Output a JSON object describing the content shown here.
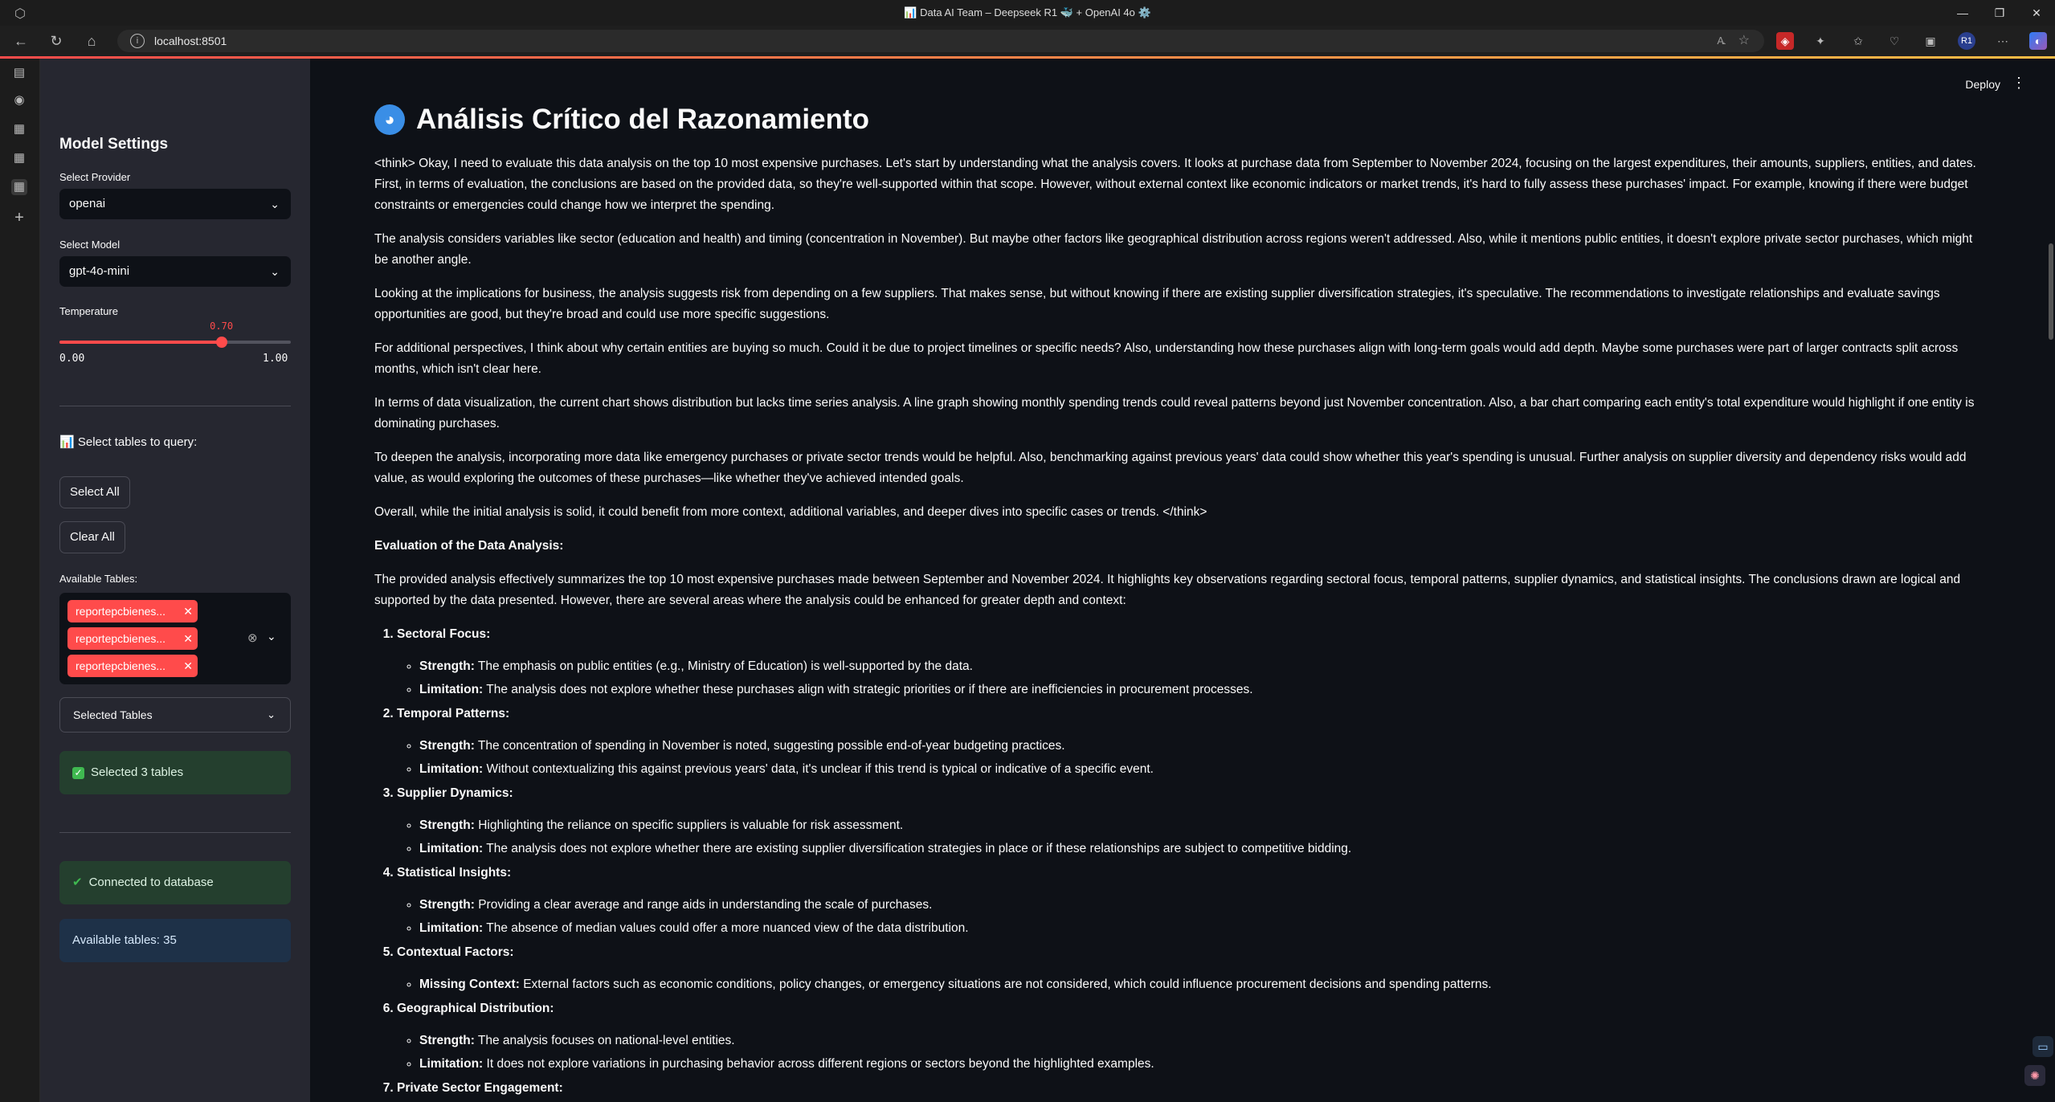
{
  "browser": {
    "window_title": "📊 Data AI Team – Deepseek R1 🐳 + OpenAI 4o ⚙️",
    "url": "localhost:8501",
    "profile_badge": "R1"
  },
  "sidebar": {
    "heading": "Model Settings",
    "provider_label": "Select Provider",
    "provider_value": "openai",
    "model_label": "Select Model",
    "model_value": "gpt-4o-mini",
    "temperature_label": "Temperature",
    "temperature_value": "0.70",
    "temperature_fraction": 0.7,
    "temperature_min": "0.00",
    "temperature_max": "1.00",
    "tables_heading": "📊 Select tables to query:",
    "select_all": "Select All",
    "clear_all": "Clear All",
    "available_label": "Available Tables:",
    "tags": [
      "reportepcbienes...",
      "reportepcbienes...",
      "reportepcbienes..."
    ],
    "selected_expander": "Selected Tables",
    "selected_status": "Selected 3 tables",
    "connected_status": "Connected to database",
    "available_count": "Available tables: 35"
  },
  "main": {
    "deploy": "Deploy",
    "title": "Análisis Crítico del Razonamiento",
    "para1a": "<think> Okay, I need to evaluate this data analysis on the top 10 most expensive purchases. Let's start by understanding what the analysis covers. It looks at purchase data from September to November 2024, focusing on the largest expenditures, their amounts, suppliers, entities, and dates.",
    "para1b": "First, in terms of evaluation, the conclusions are based on the provided data, so they're well-supported within that scope. However, without external context like economic indicators or market trends, it's hard to fully assess these purchases' impact. For example, knowing if there were budget constraints or emergencies could change how we interpret the spending.",
    "para2": "The analysis considers variables like sector (education and health) and timing (concentration in November). But maybe other factors like geographical distribution across regions weren't addressed. Also, while it mentions public entities, it doesn't explore private sector purchases, which might be another angle.",
    "para3": "Looking at the implications for business, the analysis suggests risk from depending on a few suppliers. That makes sense, but without knowing if there are existing supplier diversification strategies, it's speculative. The recommendations to investigate relationships and evaluate savings opportunities are good, but they're broad and could use more specific suggestions.",
    "para4": "For additional perspectives, I think about why certain entities are buying so much. Could it be due to project timelines or specific needs? Also, understanding how these purchases align with long-term goals would add depth. Maybe some purchases were part of larger contracts split across months, which isn't clear here.",
    "para5": "In terms of data visualization, the current chart shows distribution but lacks time series analysis. A line graph showing monthly spending trends could reveal patterns beyond just November concentration. Also, a bar chart comparing each entity's total expenditure would highlight if one entity is dominating purchases.",
    "para6": "To deepen the analysis, incorporating more data like emergency purchases or private sector trends would be helpful. Also, benchmarking against previous years' data could show whether this year's spending is unusual. Further analysis on supplier diversity and dependency risks would add value, as would exploring the outcomes of these purchases—like whether they've achieved intended goals.",
    "para7": "Overall, while the initial analysis is solid, it could benefit from more context, additional variables, and deeper dives into specific cases or trends. </think>",
    "eval_heading": "Evaluation of the Data Analysis:",
    "para8": "The provided analysis effectively summarizes the top 10 most expensive purchases made between September and November 2024. It highlights key observations regarding sectoral focus, temporal patterns, supplier dynamics, and statistical insights. The conclusions drawn are logical and supported by the data presented. However, there are several areas where the analysis could be enhanced for greater depth and context:",
    "items": [
      {
        "title": "Sectoral Focus:",
        "subs": [
          {
            "label": "Strength:",
            "text": "The emphasis on public entities (e.g., Ministry of Education) is well-supported by the data."
          },
          {
            "label": "Limitation:",
            "text": "The analysis does not explore whether these purchases align with strategic priorities or if there are inefficiencies in procurement processes."
          }
        ]
      },
      {
        "title": "Temporal Patterns:",
        "subs": [
          {
            "label": "Strength:",
            "text": "The concentration of spending in November is noted, suggesting possible end-of-year budgeting practices."
          },
          {
            "label": "Limitation:",
            "text": "Without contextualizing this against previous years' data, it's unclear if this trend is typical or indicative of a specific event."
          }
        ]
      },
      {
        "title": "Supplier Dynamics:",
        "subs": [
          {
            "label": "Strength:",
            "text": "Highlighting the reliance on specific suppliers is valuable for risk assessment."
          },
          {
            "label": "Limitation:",
            "text": "The analysis does not explore whether there are existing supplier diversification strategies in place or if these relationships are subject to competitive bidding."
          }
        ]
      },
      {
        "title": "Statistical Insights:",
        "subs": [
          {
            "label": "Strength:",
            "text": "Providing a clear average and range aids in understanding the scale of purchases."
          },
          {
            "label": "Limitation:",
            "text": "The absence of median values could offer a more nuanced view of the data distribution."
          }
        ]
      },
      {
        "title": "Contextual Factors:",
        "subs": [
          {
            "label": "Missing Context:",
            "text": "External factors such as economic conditions, policy changes, or emergency situations are not considered, which could influence procurement decisions and spending patterns."
          }
        ]
      },
      {
        "title": "Geographical Distribution:",
        "subs": [
          {
            "label": "Strength:",
            "text": "The analysis focuses on national-level entities."
          },
          {
            "label": "Limitation:",
            "text": "It does not explore variations in purchasing behavior across different regions or sectors beyond the highlighted examples."
          }
        ]
      },
      {
        "title": "Private Sector Engagement:",
        "subs": []
      }
    ]
  }
}
